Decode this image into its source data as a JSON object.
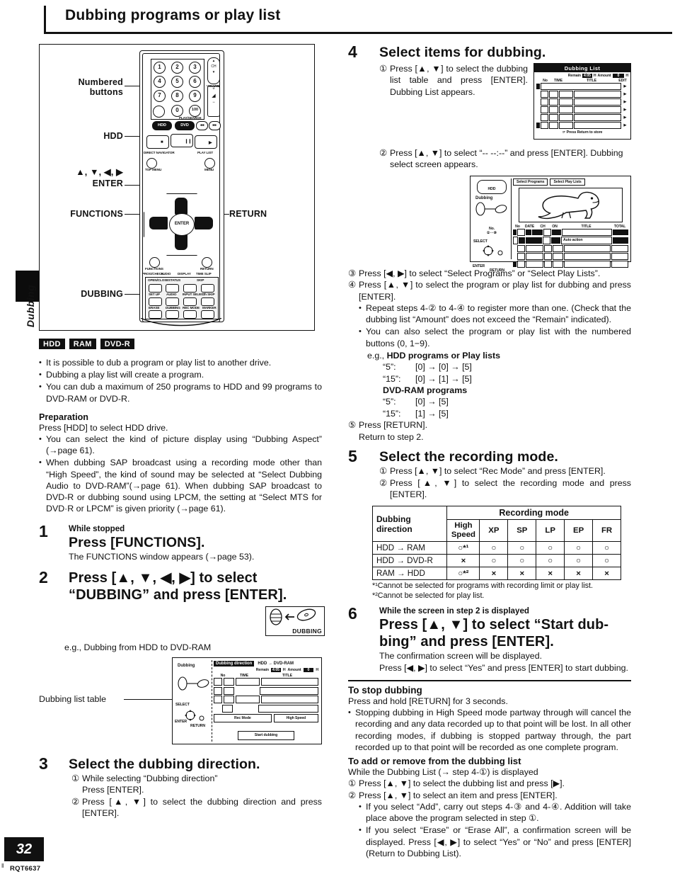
{
  "page": {
    "title": "Dubbing programs or play list",
    "number": "32",
    "code": "RQT6637",
    "side_tab": "Dubbing"
  },
  "remote": {
    "callouts": {
      "numbered_buttons_line1": "Numbered",
      "numbered_buttons_line2": "buttons",
      "hdd": "HDD",
      "arrows": "▲, ▼, ◀, ▶",
      "enter": "ENTER",
      "functions": "FUNCTIONS",
      "return": "RETURN",
      "dubbing": "DUBBING"
    },
    "keypad": [
      "1",
      "2",
      "3",
      "4",
      "5",
      "6",
      "7",
      "8",
      "9",
      "0",
      "100"
    ],
    "rocker_ch": "CH",
    "rocker_vol": "VOLUME",
    "drive_buttons": [
      "HDD",
      "DVD"
    ],
    "skip_search_label": "PLAY/SEARCH",
    "direct_nav": "DIRECT NAVIGATOR",
    "top_menu": "TOP MENU",
    "play_list": "PLAY LIST",
    "menu": "MENU",
    "enter_key": "ENTER",
    "small_buttons_row1": [
      "PROG/CHECK",
      "AUDIO",
      "DISPLAY",
      "TIME SLIP"
    ],
    "panel_row1": [
      "OPEN/CLOSE",
      "STATUS",
      "SKIP"
    ],
    "panel_row2": [
      "SET UP",
      "AUDIO",
      "INPUT SELECT",
      "Ch SKIP"
    ],
    "panel_row3": [
      "ERASE",
      "DUBBING",
      "REC MODE",
      "MARKER"
    ]
  },
  "badges": [
    "HDD",
    "RAM",
    "DVD-R"
  ],
  "intro_bullets": [
    "It is possible to dub a program or play list to another drive.",
    "Dubbing a play list will create a program.",
    "You can dub a maximum of 250 programs to HDD and 99 programs to DVD-RAM or DVD-R."
  ],
  "preparation": {
    "heading": "Preparation",
    "line": "Press [HDD] to select HDD drive.",
    "bullets": [
      "You can select the kind of picture display using “Dubbing Aspect” (→page 61).",
      "When dubbing SAP broadcast using a recording mode other than “High Speed”, the kind of sound may be selected at “Select Dubbing Audio to DVD-RAM”(→page 61). When dubbing SAP broadcast to DVD-R or dubbing sound using LPCM, the setting at “Select MTS for DVD·R or LPCM” is given priority (→page 61)."
    ]
  },
  "steps": {
    "s1": {
      "num": "1",
      "pre": "While stopped",
      "head": "Press [FUNCTIONS].",
      "body": "The FUNCTIONS window appears (→page 53)."
    },
    "s2": {
      "num": "2",
      "head_l1": "Press  [▲,  ▼,  ◀,  ▶]  to  select",
      "head_l2": "“DUBBING” and press [ENTER].",
      "icon_label": "DUBBING",
      "eg": "e.g.,  Dubbing from HDD to DVD-RAM",
      "callout": "Dubbing list table"
    },
    "s3": {
      "num": "3",
      "head": "Select the dubbing direction.",
      "items": [
        {
          "mark": "①",
          "text": "While selecting “Dubbing direction”"
        },
        {
          "mark": "",
          "text": "Press [ENTER]."
        },
        {
          "mark": "②",
          "text": "Press [▲, ▼] to select the dubbing direction and press [ENTER]."
        }
      ]
    },
    "s4": {
      "num": "4",
      "head": "Select items for dubbing.",
      "i1": "Press [▲, ▼] to select the dubbing list table and press [ENTER]. Dubbing List appears.",
      "i2": "Press [▲, ▼] to select “-- --:--” and press [ENTER]. Dubbing select screen appears.",
      "i3": "Press [◀, ▶] to select “Select Programs” or “Select Play Lists”.",
      "i4": "Press [▲, ▼] to select the program or play list for dubbing and press [ENTER].",
      "sub1": "Repeat steps 4-② to 4-④ to register more than one. (Check that the dubbing list “Amount” does not exceed the “Remain” indicated).",
      "sub2": "You can also select the program or play list with the numbered buttons (0, 1−9).",
      "eg_label": "e.g.,",
      "eg_hdd": "HDD programs or Play lists",
      "eg_hdd_rows": [
        {
          "k": "“5”:",
          "v": "[0] → [0] → [5]"
        },
        {
          "k": "“15”:",
          "v": "[0] → [1] → [5]"
        }
      ],
      "eg_ram": "DVD-RAM programs",
      "eg_ram_rows": [
        {
          "k": "“5”:",
          "v": "[0] → [5]"
        },
        {
          "k": "“15”:",
          "v": "[1] → [5]"
        }
      ],
      "i5": "Press [RETURN].",
      "i5b": "Return to step 2."
    },
    "s5": {
      "num": "5",
      "head": "Select the recording mode.",
      "i1": "Press [▲, ▼] to select “Rec Mode” and press [ENTER].",
      "i2": "Press [▲, ▼] to select the recording mode and press [ENTER]."
    },
    "s6": {
      "num": "6",
      "pre": "While the screen in step 2 is displayed",
      "head_l1": "Press [▲, ▼] to select “Start dub-",
      "head_l2": "bing” and press [ENTER].",
      "body1": "The confirmation screen will be displayed.",
      "body2": "Press [◀, ▶] to select “Yes” and press [ENTER] to start dubbing."
    }
  },
  "rec_table": {
    "col_group": "Recording mode",
    "row_header_l1": "Dubbing",
    "row_header_l2": "direction",
    "modes": [
      "High Speed",
      "XP",
      "SP",
      "LP",
      "EP",
      "FR"
    ],
    "rows": [
      {
        "direction": "HDD → RAM",
        "cells": [
          "○*¹",
          "○",
          "○",
          "○",
          "○",
          "○"
        ]
      },
      {
        "direction": "HDD → DVD-R",
        "cells": [
          "×",
          "○",
          "○",
          "○",
          "○",
          "○"
        ]
      },
      {
        "direction": "RAM → HDD",
        "cells": [
          "○*²",
          "×",
          "×",
          "×",
          "×",
          "×"
        ]
      }
    ],
    "footnotes": [
      "*¹Cannot be selected for programs with recording limit or play list.",
      "*²Cannot be selected for play list."
    ]
  },
  "stop_dubbing": {
    "heading": "To stop dubbing",
    "line": "Press and hold [RETURN] for 3 seconds.",
    "bullet": "Stopping dubbing in High Speed mode partway through will cancel the recording and any data recorded up to that point will be lost. In all other recording modes, if dubbing is stopped partway through, the part recorded up to that point will be recorded as one complete program."
  },
  "add_remove": {
    "heading": "To add or remove from the dubbing list",
    "line": "While the Dubbing List (→ step 4-①) is displayed",
    "items": [
      {
        "mark": "①",
        "text": "Press [▲, ▼] to select the dubbing list and press [▶]."
      },
      {
        "mark": "②",
        "text": "Press [▲, ▼] to select an item and press [ENTER]."
      }
    ],
    "bullets": [
      "If you select “Add”, carry out steps 4-③ and 4-④. Addition will take place above the program selected in step ①.",
      "If you select “Erase” or “Erase All”, a confirmation screen will be displayed. Press [◀, ▶] to select “Yes” or “No” and press [ENTER] (Return to Dubbing List)."
    ]
  },
  "osd_dubbing_list": {
    "title": "Dubbing List",
    "remain_label": "Remain",
    "remain_value": "4:05",
    "unit": "H",
    "amount_label": "Amount",
    "amount_value": "0",
    "cols": [
      "No",
      "TIME",
      "TITLE",
      "EDIT"
    ],
    "footer": "Press Return to store"
  },
  "osd_select": {
    "drive": "HDD",
    "mode": "Dubbing",
    "tab1": "Select Programs",
    "tab2": "Select Play Lists",
    "no_label": "No.",
    "no_range": "①⋯⑨",
    "cols": [
      "No",
      "DATE",
      "CH",
      "ON",
      "TITLE",
      "TOTAL"
    ],
    "sample_title": "Auto action",
    "select_label": "SELECT",
    "enter_label": "ENTER",
    "return_label": "RETURN"
  },
  "osd_main": {
    "mode": "Dubbing",
    "direction_label": "Dubbing direction",
    "direction_value": "HDD  →  DVD-RAM",
    "remain_label": "Remain",
    "remain_value": "4:05",
    "amount_label": "Amount",
    "amount_value": "0",
    "unit": "H",
    "cols": [
      "No",
      "TIME",
      "TITLE"
    ],
    "rec_mode_label": "Rec Mode",
    "rec_mode_value": "High Speed",
    "start_button": "Start dubbing",
    "select_label": "SELECT",
    "enter_label": "ENTER",
    "return_label": "RETURN"
  }
}
